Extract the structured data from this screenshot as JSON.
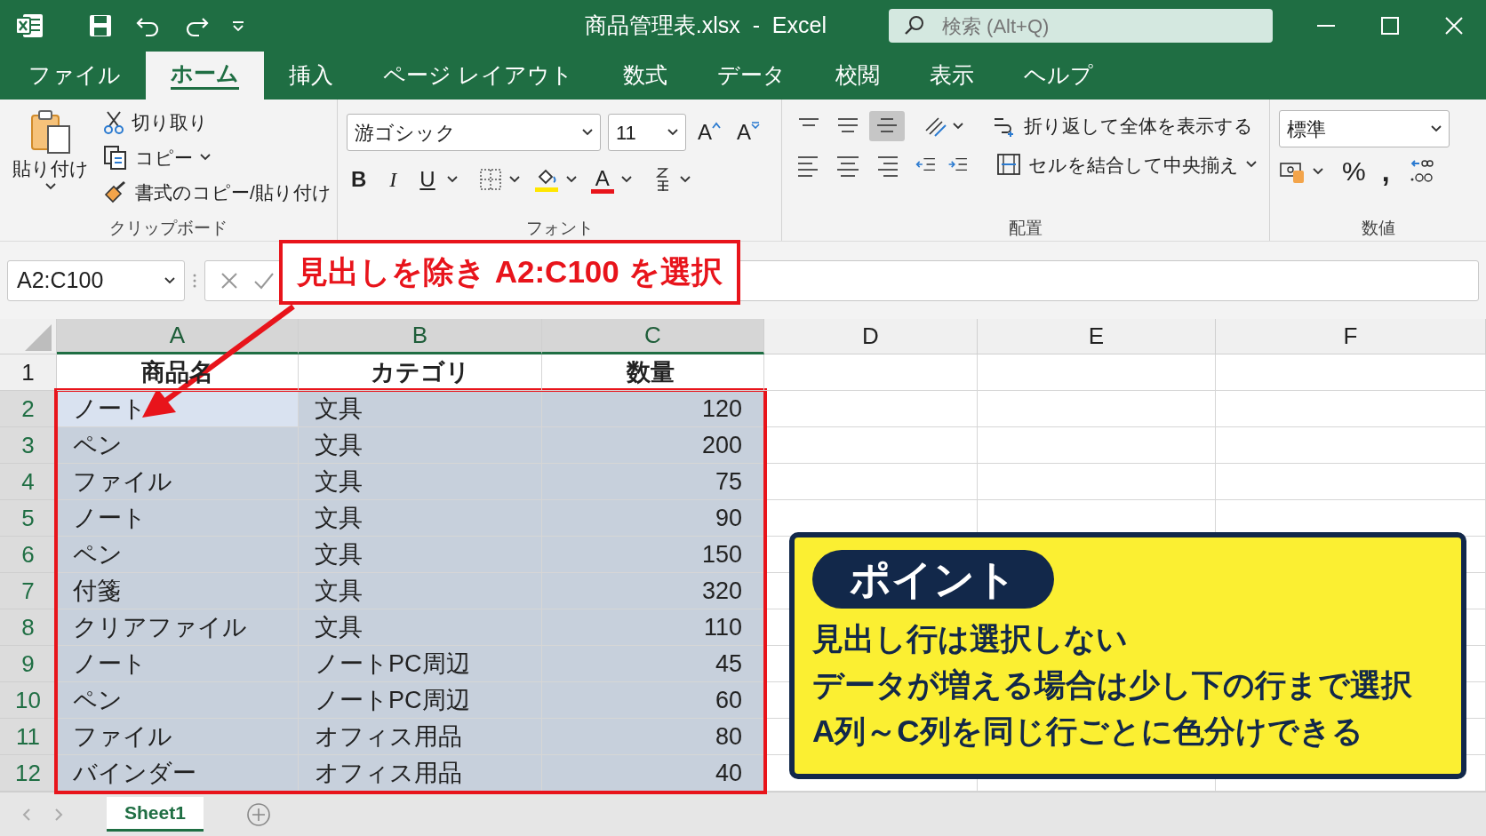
{
  "window": {
    "title": "商品管理表.xlsx  -  Excel",
    "search_placeholder": "検索 (Alt+Q)"
  },
  "tabs": [
    {
      "label": "ファイル",
      "selected": false
    },
    {
      "label": "ホーム",
      "selected": true
    },
    {
      "label": "挿入",
      "selected": false
    },
    {
      "label": "ページ レイアウト",
      "selected": false
    },
    {
      "label": "数式",
      "selected": false
    },
    {
      "label": "データ",
      "selected": false
    },
    {
      "label": "校閲",
      "selected": false
    },
    {
      "label": "表示",
      "selected": false
    },
    {
      "label": "ヘルプ",
      "selected": false
    }
  ],
  "ribbon": {
    "clipboard": {
      "paste": "貼り付け",
      "cut": "切り取り",
      "copy": "コピー",
      "format_painter": "書式のコピー/貼り付け",
      "label": "クリップボード"
    },
    "font": {
      "name": "游ゴシック",
      "size": "11",
      "grow": "A",
      "shrink": "A",
      "bold": "B",
      "italic": "I",
      "underline": "U",
      "font_color": "A",
      "label": "フォント"
    },
    "alignment": {
      "vertical": [
        {
          "selected": false
        },
        {
          "selected": false
        },
        {
          "selected": true
        }
      ],
      "horizontal": [
        {
          "selected": false
        },
        {
          "selected": false
        },
        {
          "selected": false
        }
      ],
      "wrap_text": "折り返して全体を表示する",
      "merge": "セルを結合して中央揃え",
      "label": "配置"
    },
    "number": {
      "format": "標準",
      "percent": "%",
      "comma": ",",
      "label": "数値"
    }
  },
  "formula_bar": {
    "name_box": "A2:C100"
  },
  "sheet": {
    "columns": [
      {
        "label": "A",
        "selected": true,
        "kind": "text"
      },
      {
        "label": "B",
        "selected": true,
        "kind": "text"
      },
      {
        "label": "C",
        "selected": true,
        "kind": "number"
      },
      {
        "label": "D",
        "selected": false,
        "kind": "text"
      },
      {
        "label": "E",
        "selected": false,
        "kind": "text"
      },
      {
        "label": "F",
        "selected": false,
        "kind": "text"
      }
    ],
    "rows": [
      {
        "label": "1",
        "selected": false,
        "kind": "heading",
        "cells": [
          {
            "text": "商品名",
            "active": false
          },
          {
            "text": "カテゴリ",
            "active": false
          },
          {
            "text": "数量",
            "active": false
          }
        ]
      },
      {
        "label": "2",
        "selected": true,
        "kind": "data",
        "cells": [
          {
            "text": "ノート",
            "active": true
          },
          {
            "text": "文具",
            "active": false
          },
          {
            "text": "120",
            "active": false
          }
        ]
      },
      {
        "label": "3",
        "selected": true,
        "kind": "data",
        "cells": [
          {
            "text": "ペン",
            "active": false
          },
          {
            "text": "文具",
            "active": false
          },
          {
            "text": "200",
            "active": false
          }
        ]
      },
      {
        "label": "4",
        "selected": true,
        "kind": "data",
        "cells": [
          {
            "text": "ファイル",
            "active": false
          },
          {
            "text": "文具",
            "active": false
          },
          {
            "text": "75",
            "active": false
          }
        ]
      },
      {
        "label": "5",
        "selected": true,
        "kind": "data",
        "cells": [
          {
            "text": "ノート",
            "active": false
          },
          {
            "text": "文具",
            "active": false
          },
          {
            "text": "90",
            "active": false
          }
        ]
      },
      {
        "label": "6",
        "selected": true,
        "kind": "data",
        "cells": [
          {
            "text": "ペン",
            "active": false
          },
          {
            "text": "文具",
            "active": false
          },
          {
            "text": "150",
            "active": false
          }
        ]
      },
      {
        "label": "7",
        "selected": true,
        "kind": "data",
        "cells": [
          {
            "text": "付箋",
            "active": false
          },
          {
            "text": "文具",
            "active": false
          },
          {
            "text": "320",
            "active": false
          }
        ]
      },
      {
        "label": "8",
        "selected": true,
        "kind": "data",
        "cells": [
          {
            "text": "クリアファイル",
            "active": false
          },
          {
            "text": "文具",
            "active": false
          },
          {
            "text": "110",
            "active": false
          }
        ]
      },
      {
        "label": "9",
        "selected": true,
        "kind": "data",
        "cells": [
          {
            "text": "ノート",
            "active": false
          },
          {
            "text": "ノートPC周辺",
            "active": false
          },
          {
            "text": "45",
            "active": false
          }
        ]
      },
      {
        "label": "10",
        "selected": true,
        "kind": "data",
        "cells": [
          {
            "text": "ペン",
            "active": false
          },
          {
            "text": "ノートPC周辺",
            "active": false
          },
          {
            "text": "60",
            "active": false
          }
        ]
      },
      {
        "label": "11",
        "selected": true,
        "kind": "data",
        "cells": [
          {
            "text": "ファイル",
            "active": false
          },
          {
            "text": "オフィス用品",
            "active": false
          },
          {
            "text": "80",
            "active": false
          }
        ]
      },
      {
        "label": "12",
        "selected": true,
        "kind": "data",
        "cells": [
          {
            "text": "バインダー",
            "active": false
          },
          {
            "text": "オフィス用品",
            "active": false
          },
          {
            "text": "40",
            "active": false
          }
        ]
      }
    ]
  },
  "sheet_tabs": [
    {
      "label": "Sheet1",
      "selected": true
    }
  ],
  "callout": {
    "text": "見出しを除き A2:C100 を選択"
  },
  "note": {
    "title": "ポイント",
    "lines": [
      "見出し行は選択しない",
      "データが増える場合は少し下の行まで選択",
      "A列～C列を同じ行ごとに色分けできる"
    ]
  }
}
